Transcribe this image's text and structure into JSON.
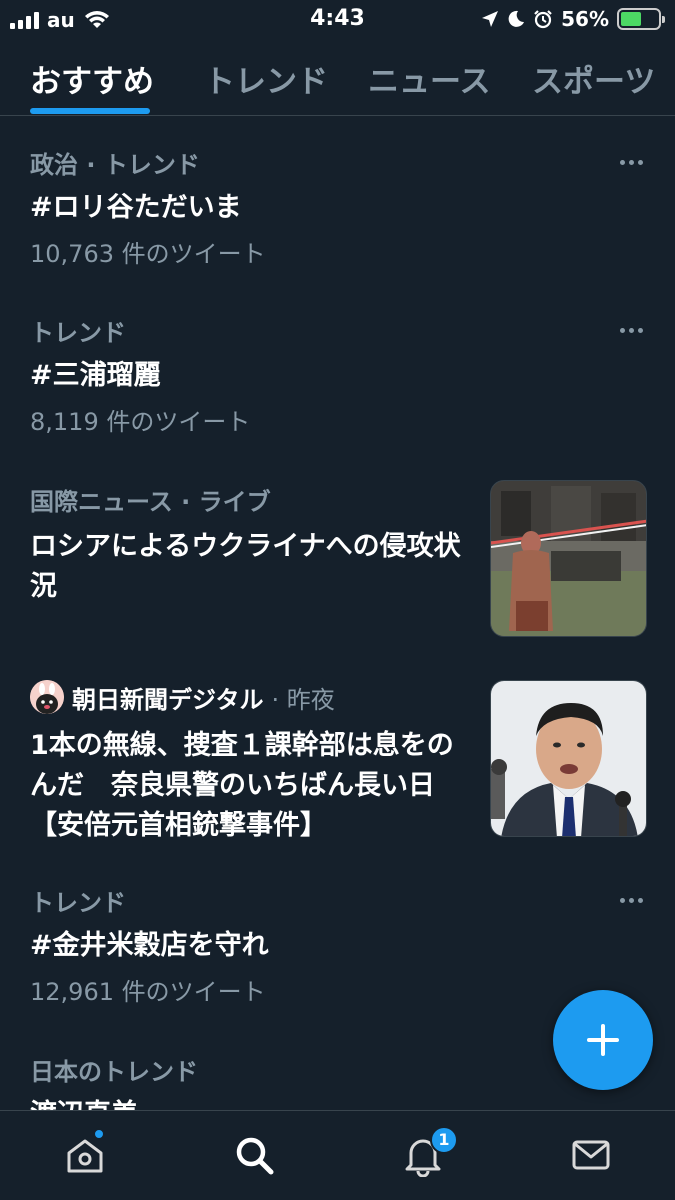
{
  "status": {
    "carrier": "au",
    "time": "4:43",
    "battery": "56%",
    "battery_level": 0.56
  },
  "tabs": [
    {
      "label": "おすすめ",
      "active": true
    },
    {
      "label": "トレンド",
      "active": false
    },
    {
      "label": "ニュース",
      "active": false
    },
    {
      "label": "スポーツ",
      "active": false
    }
  ],
  "feed": {
    "item1": {
      "meta": "政治 · トレンド",
      "title": "#ロリ谷ただいま",
      "count": "10,763 件のツイート"
    },
    "item2": {
      "meta": "トレンド",
      "title": "#三浦瑠麗",
      "count": "8,119 件のツイート"
    },
    "item3": {
      "meta": "国際ニュース · ライブ",
      "title": "ロシアによるウクライナへの侵攻状況"
    },
    "item4": {
      "source": "朝日新聞デジタル",
      "time": "· 昨夜",
      "title": "1本の無線、捜査１課幹部は息をのんだ　奈良県警のいちばん長い日【安倍元首相銃撃事件】"
    },
    "item5": {
      "meta": "トレンド",
      "title": "#金井米穀店を守れ",
      "count": "12,961 件のツイート"
    },
    "item6": {
      "meta": "日本のトレンド",
      "title": "渡辺直美"
    }
  },
  "nav": {
    "notifications_badge": "1"
  },
  "colors": {
    "background": "#15202b",
    "accent": "#1d9bf0",
    "secondary_text": "#8899a6",
    "divider": "#38444d"
  },
  "icons": [
    "home-icon",
    "search-icon",
    "bell-icon",
    "mail-icon",
    "compose-plus-icon",
    "more-icon"
  ]
}
